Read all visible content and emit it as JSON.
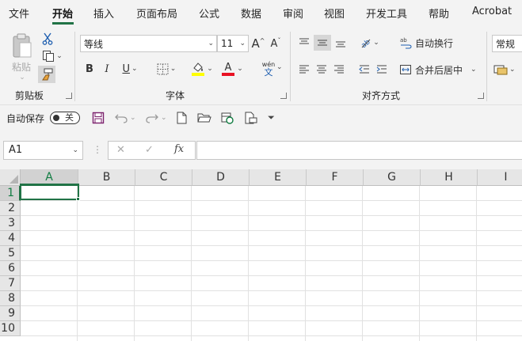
{
  "tabs": [
    "文件",
    "开始",
    "插入",
    "页面布局",
    "公式",
    "数据",
    "审阅",
    "视图",
    "开发工具",
    "帮助",
    "Acrobat"
  ],
  "active_tab": "开始",
  "clipboard": {
    "paste_label": "粘贴",
    "group_label": "剪贴板"
  },
  "font": {
    "name": "等线",
    "size": "11",
    "group_label": "字体",
    "phonetic_top": "wén",
    "phonetic_bottom": "文",
    "bold": "B",
    "italic": "I",
    "underline": "U",
    "grow": "A",
    "shrink": "A",
    "highlight_color": "#ffff00",
    "font_color": "#e81123"
  },
  "alignment": {
    "wrap_label": "自动换行",
    "merge_label": "合并后居中",
    "group_label": "对齐方式"
  },
  "number": {
    "format": "常规"
  },
  "qat": {
    "autosave_label": "自动保存",
    "toggle_label": "关"
  },
  "formula_bar": {
    "name_box": "A1",
    "fx": "fx",
    "cancel": "✕",
    "confirm": "✓",
    "value": ""
  },
  "columns": [
    "A",
    "B",
    "C",
    "D",
    "E",
    "F",
    "G",
    "H",
    "I"
  ],
  "rows": [
    "1",
    "2",
    "3",
    "4",
    "5",
    "6",
    "7",
    "8",
    "9",
    "10"
  ],
  "active_cell": "A1",
  "accent_color": "#217346"
}
